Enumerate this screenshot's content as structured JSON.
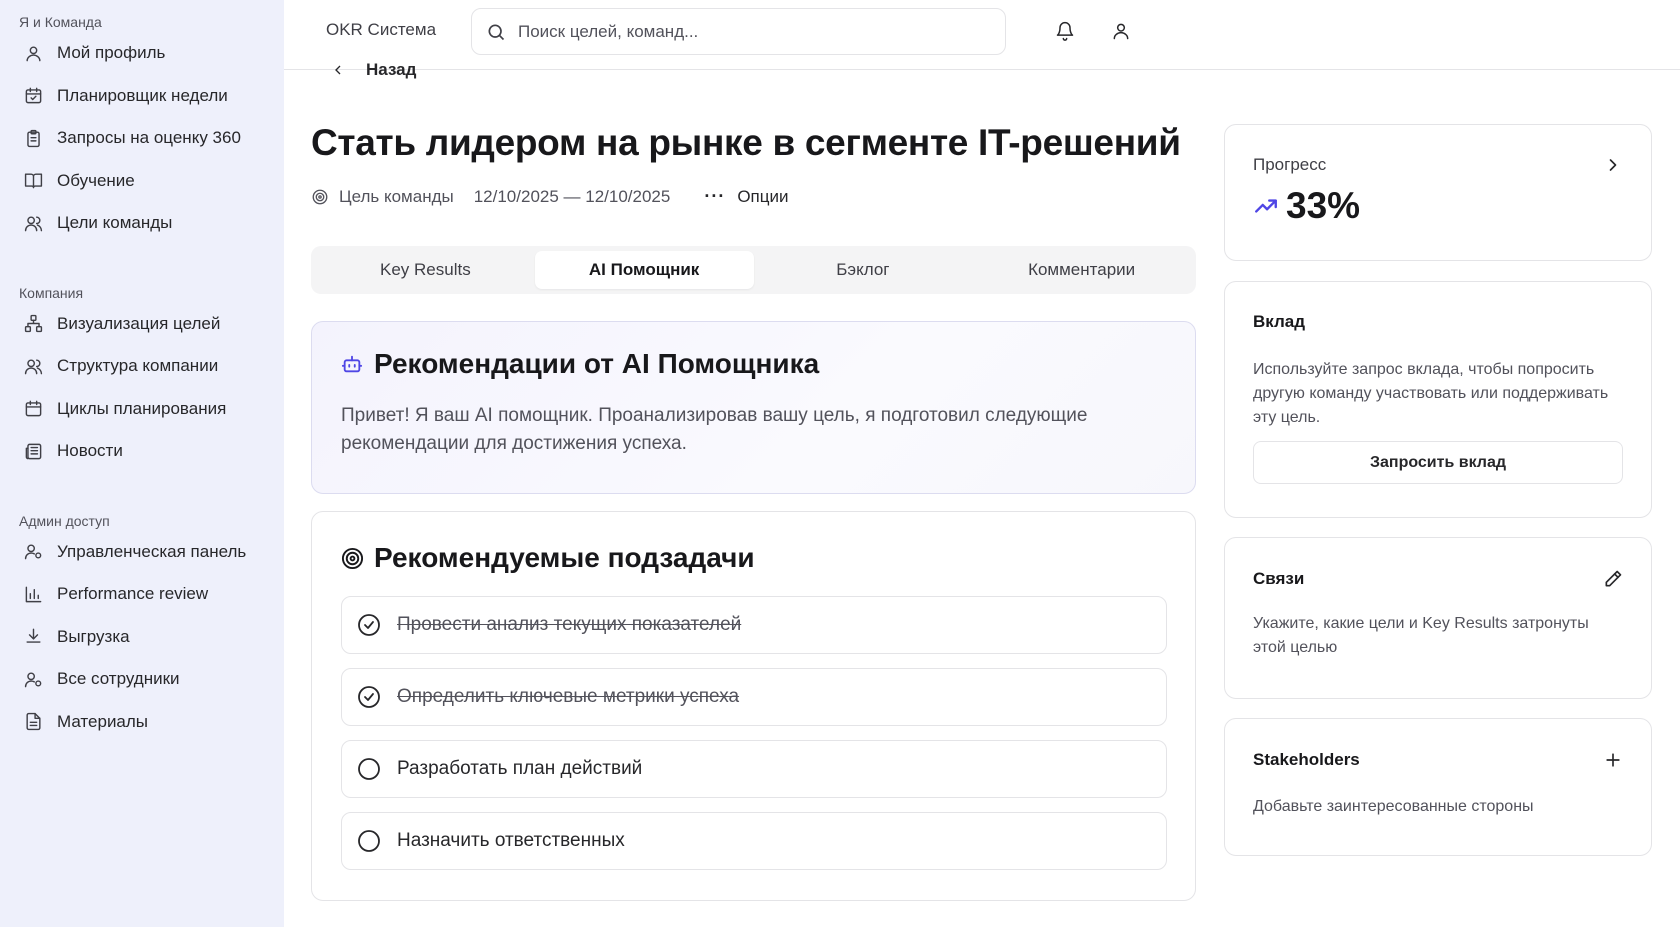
{
  "sidebar": {
    "sections": [
      {
        "title": "Я и Команда",
        "items": [
          {
            "label": "Мой профиль",
            "icon": "user-icon"
          },
          {
            "label": "Планировщик недели",
            "icon": "calendar-check-icon"
          },
          {
            "label": "Запросы на оценку 360",
            "icon": "clipboard-icon"
          },
          {
            "label": "Обучение",
            "icon": "book-icon"
          },
          {
            "label": "Цели команды",
            "icon": "users-icon"
          }
        ]
      },
      {
        "title": "Компания",
        "items": [
          {
            "label": "Визуализация целей",
            "icon": "network-icon"
          },
          {
            "label": "Структура компании",
            "icon": "users-icon"
          },
          {
            "label": "Циклы планирования",
            "icon": "calendar-icon"
          },
          {
            "label": "Новости",
            "icon": "newspaper-icon"
          }
        ]
      },
      {
        "title": "Админ доступ",
        "items": [
          {
            "label": "Управленческая панель",
            "icon": "user-cog-icon"
          },
          {
            "label": "Performance review",
            "icon": "bar-chart-icon"
          },
          {
            "label": "Выгрузка",
            "icon": "download-icon"
          },
          {
            "label": "Все сотрудники",
            "icon": "user-cog-icon"
          },
          {
            "label": "Материалы",
            "icon": "file-text-icon"
          }
        ]
      }
    ]
  },
  "header": {
    "brand": "OKR Система",
    "search_placeholder": "Поиск целей, команд..."
  },
  "main": {
    "back_label": "Назад",
    "title": "Стать лидером на рынке в сегменте IT-решений",
    "goal_type": "Цель команды",
    "dates": "12/10/2025 — 12/10/2025",
    "options_label": "Опции",
    "tabs": [
      {
        "label": "Key Results",
        "active": false
      },
      {
        "label": "AI Помощник",
        "active": true
      },
      {
        "label": "Бэклог",
        "active": false
      },
      {
        "label": "Комментарии",
        "active": false
      }
    ],
    "ai_card": {
      "title": "Рекомендации от AI Помощника",
      "text": "Привет! Я ваш AI помощник. Проанализировав вашу цель, я подготовил следующие рекомендации для достижения успеха."
    },
    "tasks_card": {
      "title": "Рекомендуемые подзадачи",
      "tasks": [
        {
          "label": "Провести анализ текущих показателей",
          "done": true
        },
        {
          "label": "Определить ключевые метрики успеха",
          "done": true
        },
        {
          "label": "Разработать план действий",
          "done": false
        },
        {
          "label": "Назначить ответственных",
          "done": false
        }
      ]
    }
  },
  "right": {
    "progress": {
      "title": "Прогресс",
      "value": "33%"
    },
    "contribution": {
      "title": "Вклад",
      "text": "Используйте запрос вклада, чтобы попросить другую команду участвовать или поддерживать эту цель.",
      "button": "Запросить вклад"
    },
    "links": {
      "title": "Связи",
      "text": "Укажите, какие цели и Key Results затронуты этой целью"
    },
    "stakeholders": {
      "title": "Stakeholders",
      "text": "Добавьте заинтересованные стороны"
    }
  },
  "colors": {
    "sidebar_bg": "#eef0fb",
    "accent": "#4f46e5",
    "border": "#e4e4e7"
  }
}
